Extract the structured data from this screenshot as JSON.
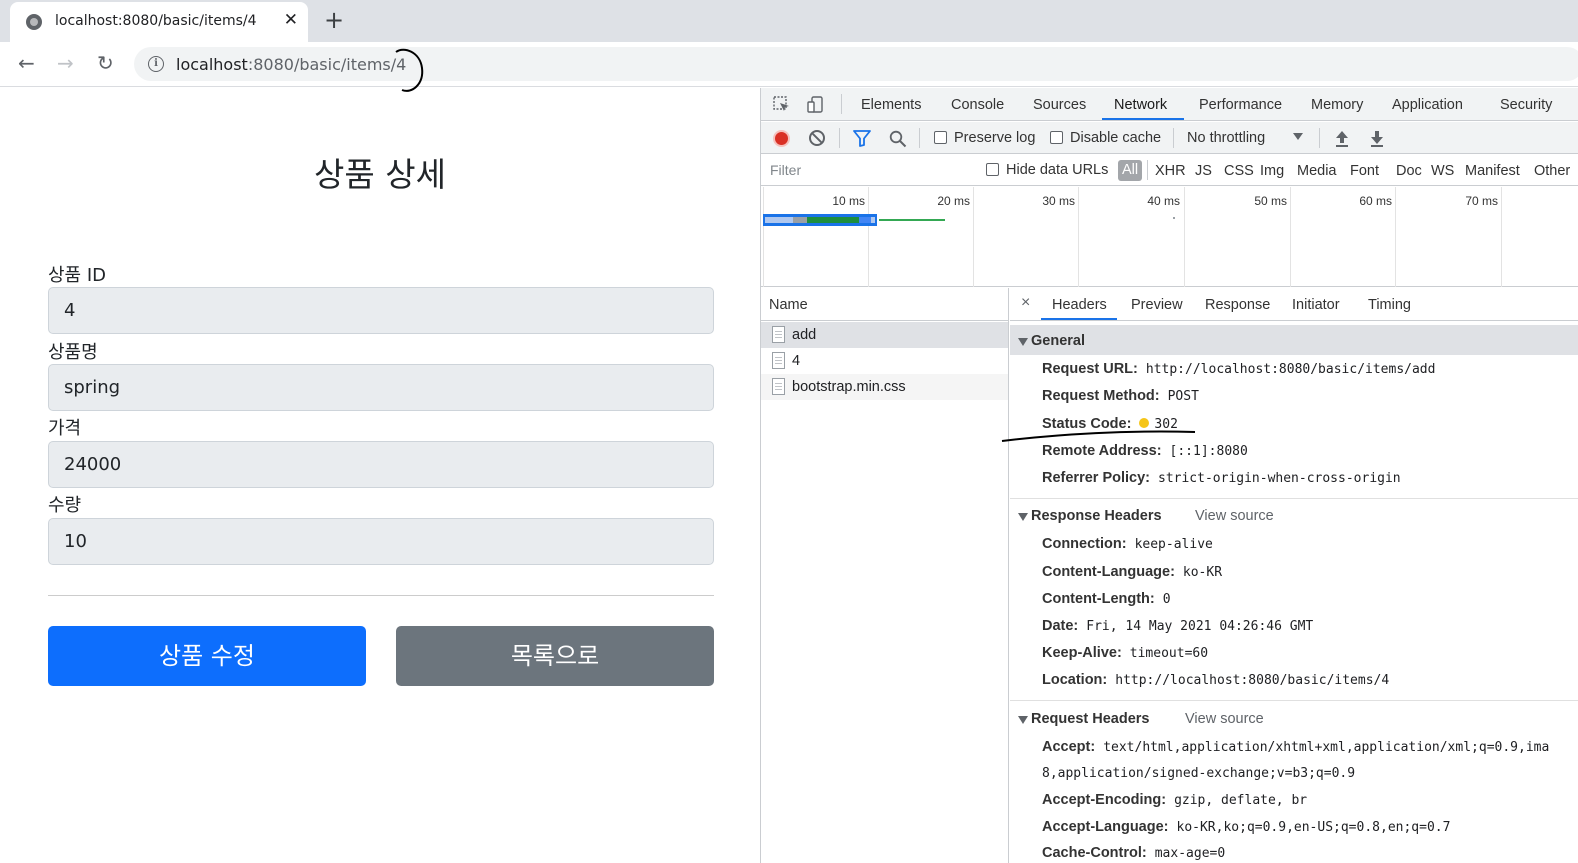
{
  "browser": {
    "tab_title": "localhost:8080/basic/items/4",
    "tab_close": "✕",
    "new_tab": "+",
    "back": "←",
    "forward": "→",
    "reload": "↻",
    "info": "i",
    "url_host": "localhost",
    "url_path": ":8080/basic/items/4"
  },
  "page": {
    "title": "상품 상세",
    "fields": [
      {
        "label": "상품 ID",
        "value": "4"
      },
      {
        "label": "상품명",
        "value": "spring"
      },
      {
        "label": "가격",
        "value": "24000"
      },
      {
        "label": "수량",
        "value": "10"
      }
    ],
    "edit_button": "상품 수정",
    "list_button": "목록으로"
  },
  "devtools": {
    "tabs": [
      "Elements",
      "Console",
      "Sources",
      "Network",
      "Performance",
      "Memory",
      "Application",
      "Security"
    ],
    "active_tab": "Network",
    "network_toolbar": {
      "preserve_log": "Preserve log",
      "disable_cache": "Disable cache",
      "throttling": "No throttling"
    },
    "filter": {
      "placeholder": "Filter",
      "hide_data_urls": "Hide data URLs",
      "types": [
        "All",
        "XHR",
        "JS",
        "CSS",
        "Img",
        "Media",
        "Font",
        "Doc",
        "WS",
        "Manifest",
        "Other"
      ]
    },
    "timeline_labels": [
      "10 ms",
      "20 ms",
      "30 ms",
      "40 ms",
      "50 ms",
      "60 ms",
      "70 ms"
    ],
    "name_header": "Name",
    "requests": [
      "add",
      "4",
      "bootstrap.min.css"
    ],
    "detail_close": "×",
    "detail_tabs": [
      "Headers",
      "Preview",
      "Response",
      "Initiator",
      "Timing"
    ],
    "general": {
      "title": "General",
      "request_url_label": "Request URL:",
      "request_url": "http://localhost:8080/basic/items/add",
      "request_method_label": "Request Method:",
      "request_method": "POST",
      "status_code_label": "Status Code:",
      "status_code": "302",
      "remote_address_label": "Remote Address:",
      "remote_address": "[::1]:8080",
      "referrer_policy_label": "Referrer Policy:",
      "referrer_policy": "strict-origin-when-cross-origin"
    },
    "response_headers": {
      "title": "Response Headers",
      "view_source": "View source",
      "connection_label": "Connection:",
      "connection": "keep-alive",
      "content_language_label": "Content-Language:",
      "content_language": "ko-KR",
      "content_length_label": "Content-Length:",
      "content_length": "0",
      "date_label": "Date:",
      "date": "Fri, 14 May 2021 04:26:46 GMT",
      "keep_alive_label": "Keep-Alive:",
      "keep_alive": "timeout=60",
      "location_label": "Location:",
      "location": "http://localhost:8080/basic/items/4"
    },
    "request_headers": {
      "title": "Request Headers",
      "view_source": "View source",
      "accept_label": "Accept:",
      "accept": "text/html,application/xhtml+xml,application/xml;q=0.9,ima",
      "accept_cont": "8,application/signed-exchange;v=b3;q=0.9",
      "accept_encoding_label": "Accept-Encoding:",
      "accept_encoding": "gzip, deflate, br",
      "accept_language_label": "Accept-Language:",
      "accept_language": "ko-KR,ko;q=0.9,en-US;q=0.8,en;q=0.7",
      "cache_control_label": "Cache-Control:",
      "cache_control": "max-age=0"
    }
  },
  "colors": {
    "primary": "#0d6efd",
    "secondary": "#6c757d",
    "devtools_accent": "#1a73e8",
    "record": "#d93025",
    "status_warning": "#f5c518"
  }
}
